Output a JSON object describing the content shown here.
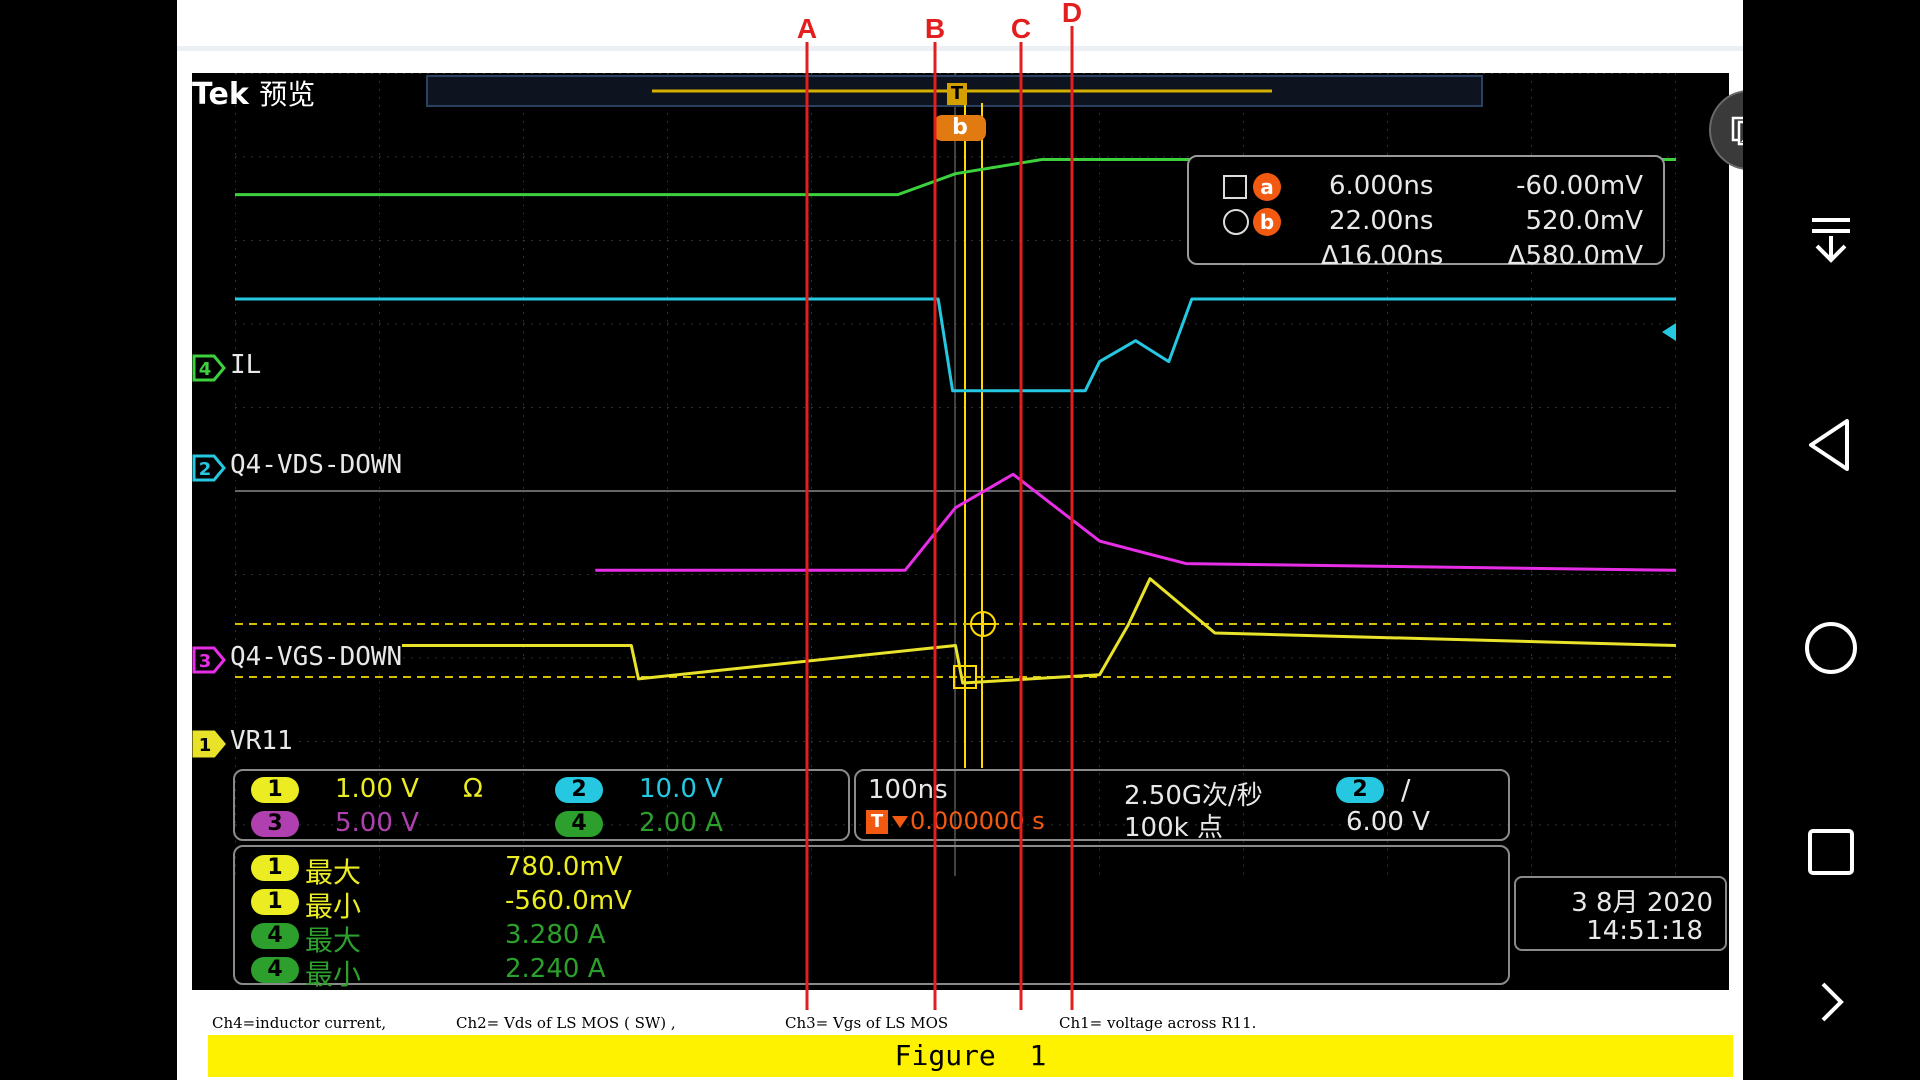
{
  "scope": {
    "brand": "Tek",
    "mode": "预览",
    "trigger_marker": "T",
    "cursor_marker": "b",
    "cursor_readout": {
      "a_symbol": "a",
      "b_symbol": "b",
      "a_time": "6.000ns",
      "a_value": "-60.00mV",
      "b_time": "22.00ns",
      "b_value": "520.0mV",
      "delta_time": "Δ16.00ns",
      "delta_value": "Δ580.0mV"
    },
    "channels": [
      {
        "num": "4",
        "label": "IL",
        "color": "#3dd13d"
      },
      {
        "num": "2",
        "label": "Q4-VDS-DOWN",
        "color": "#25c8e0"
      },
      {
        "num": "3",
        "label": "Q4-VGS-DOWN",
        "color": "#e62ee6"
      },
      {
        "num": "1",
        "label": "VR11",
        "color": "#e8e22a"
      }
    ],
    "scales": [
      {
        "num": "1",
        "value": "1.00 V",
        "extra": "Ω",
        "color": "#ecec22"
      },
      {
        "num": "2",
        "value": "10.0 V",
        "extra": "",
        "color": "#25c8e0"
      },
      {
        "num": "3",
        "value": "5.00 V",
        "extra": "",
        "color": "#b040b0"
      },
      {
        "num": "4",
        "value": "2.00 A",
        "extra": "",
        "color": "#2c9f2c"
      }
    ],
    "timebase": {
      "time_div": "100ns",
      "sample_rate": "2.50G次/秒",
      "trigger_pos_prefix": "T",
      "trigger_pos": "0.000000 s",
      "record_length": "100k 点",
      "trig_channel": "2",
      "trig_slope": "/",
      "trig_level": "6.00 V"
    },
    "measurements": [
      {
        "num": "1",
        "name": "最大",
        "value": "780.0mV",
        "color": "#ecec22"
      },
      {
        "num": "1",
        "name": "最小",
        "value": "-560.0mV",
        "color": "#ecec22"
      },
      {
        "num": "4",
        "name": "最大",
        "value": "3.280 A",
        "color": "#2c9f2c"
      },
      {
        "num": "4",
        "name": "最小",
        "value": "2.240 A",
        "color": "#2c9f2c"
      }
    ],
    "date": "3 8月 2020",
    "time": "14:51:18"
  },
  "annotations": {
    "markers": [
      "A",
      "B",
      "C",
      "D"
    ],
    "marker_color": "#e21e1e"
  },
  "captions": {
    "ch4": "Ch4=inductor current,",
    "ch2": "Ch2= Vds of LS MOS ( SW) ,",
    "ch3": "Ch3= Vgs of LS MOS",
    "ch1": "Ch1= voltage across R11.",
    "figure": "Figure  1"
  },
  "chart_data": {
    "type": "line",
    "title": "",
    "x_unit_per_div": "100ns",
    "x_divisions": 10,
    "x_range_ns": [
      -500,
      500
    ],
    "series": [
      {
        "name": "IL",
        "channel": "4",
        "x_ns": [
          -500,
          -40,
          0,
          60,
          500
        ],
        "values_div": [
          3.55,
          3.55,
          3.8,
          3.97,
          3.97
        ]
      },
      {
        "name": "Q4-VDS-DOWN",
        "channel": "2",
        "x_ns": [
          -500,
          -12,
          -2,
          90,
          100,
          125,
          148,
          164,
          500
        ],
        "values_div": [
          2.3,
          2.3,
          1.2,
          1.2,
          1.55,
          1.8,
          1.55,
          2.3,
          2.3
        ]
      },
      {
        "name": "Q4-VGS-DOWN",
        "channel": "3",
        "x_ns": [
          -250,
          -35,
          0,
          40,
          100,
          160,
          500
        ],
        "values_div": [
          -0.95,
          -0.95,
          -0.2,
          0.2,
          -0.6,
          -0.87,
          -0.95
        ]
      },
      {
        "name": "VR11",
        "channel": "1",
        "x_ns": [
          -500,
          -225,
          -220,
          0,
          5,
          100,
          120,
          135,
          180,
          500
        ],
        "values_div": [
          -1.85,
          -1.85,
          -2.25,
          -1.85,
          -2.3,
          -2.2,
          -1.6,
          -1.05,
          -1.7,
          -1.85
        ]
      }
    ],
    "cursors": {
      "a": {
        "time_ns": 6.0,
        "value_mV": -60.0
      },
      "b": {
        "time_ns": 22.0,
        "value_mV": 520.0
      },
      "delta": {
        "time_ns": 16.0,
        "value_mV": 580.0
      }
    },
    "grid": true
  }
}
